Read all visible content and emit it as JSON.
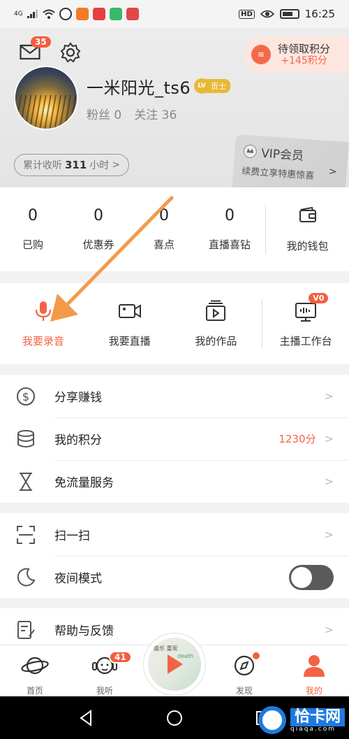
{
  "status_bar": {
    "network": "4G",
    "time": "16:25",
    "hd_label": "HD",
    "app_colors": [
      "#f57a28",
      "#e83e3e",
      "#38b86b",
      "#e04848"
    ]
  },
  "header": {
    "mail_badge": "35",
    "points_pill": {
      "title": "待领取积分",
      "amount": "+145积分"
    },
    "username": "一米阳光_ts6",
    "level_icon": "LV",
    "level_label": "贡士",
    "fans": "粉丝 0",
    "following": "关注 36",
    "listen_prefix": "累计收听",
    "listen_hours": "311",
    "listen_suffix": "小时",
    "listen_chevron": ">",
    "vip": {
      "title": "VIP会员",
      "subtitle": "续费立享特惠惊喜",
      "chevron": ">"
    }
  },
  "stats": [
    {
      "value": "0",
      "label": "已购"
    },
    {
      "value": "0",
      "label": "优惠券"
    },
    {
      "value": "0",
      "label": "喜点"
    },
    {
      "value": "0",
      "label": "直播喜钻"
    }
  ],
  "wallet_label": "我的钱包",
  "tools": [
    {
      "label": "我要录音",
      "icon": "microphone-icon",
      "active": true
    },
    {
      "label": "我要直播",
      "icon": "video-camera-icon",
      "active": false
    },
    {
      "label": "我的作品",
      "icon": "works-icon",
      "active": false
    }
  ],
  "studio": {
    "label": "主播工作台",
    "badge": "V0"
  },
  "menu_section_1": [
    {
      "label": "分享赚钱",
      "icon": "dollar-icon"
    },
    {
      "label": "我的积分",
      "icon": "coins-stack-icon",
      "value": "1230分"
    },
    {
      "label": "免流量服务",
      "icon": "hourglass-icon"
    }
  ],
  "menu_section_2": [
    {
      "label": "扫一扫",
      "icon": "scan-icon"
    },
    {
      "label": "夜间模式",
      "icon": "moon-icon",
      "toggle": false
    }
  ],
  "menu_section_3": [
    {
      "label": "帮助与反馈",
      "icon": "feedback-icon"
    }
  ],
  "chevron": ">",
  "tabbar": [
    {
      "label": "首页",
      "icon": "planet-icon"
    },
    {
      "label": "我听",
      "icon": "headphones-face-icon",
      "badge": "41"
    },
    {
      "label": "发现",
      "icon": "compass-icon",
      "dot": true
    },
    {
      "label": "我的",
      "icon": "person-icon",
      "active": true
    }
  ],
  "player": {
    "text_top": "盛乐\n重现",
    "text_tag": "death"
  },
  "watermark": {
    "title": "恰卡网",
    "url": "qiaqa.com"
  },
  "colors": {
    "accent": "#f26344",
    "badge": "#f55d3e",
    "gold": "#e9b935"
  }
}
